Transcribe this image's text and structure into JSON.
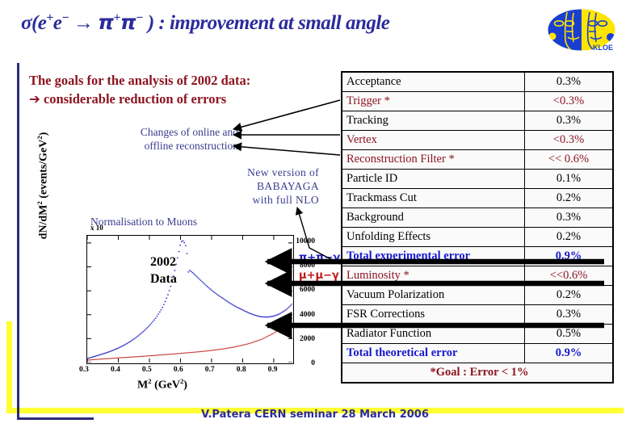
{
  "slide": {
    "title_pre": "σ(e",
    "title": "σ(e+e− → π+π−) : improvement at small angle",
    "title_tail": ") : improvement at small angle",
    "footer": "V.Patera CERN seminar 28 March 2006",
    "logo_name": "KLOE",
    "accent_navy": "#2b2b9c",
    "accent_dark_red": "#8c1420",
    "accent_blue": "#1818cf",
    "accent_yellow": "#ffff33"
  },
  "goals": {
    "line1": "The goals for the analysis of 2002 data:",
    "arrow": "➔",
    "line2": "considerable reduction of errors"
  },
  "annotations": {
    "changes_line1": "Changes of online and",
    "changes_line2": "offline reconstruction",
    "babayaga_line1": "New version of",
    "babayaga_line2": "BABAYAGA",
    "babayaga_line3": "with full NLO",
    "normalisation": "Normalisation to Muons"
  },
  "chart_data": {
    "type": "line",
    "title": "",
    "xlabel": "M² (GeV²)",
    "ylabel": "dN/dM² (events/GeV²)",
    "y_multiplier": "x 10",
    "inset_label_line1": "2002",
    "inset_label_line2": "Data",
    "xlim": [
      0.3,
      0.96
    ],
    "ylim": [
      0,
      10600
    ],
    "xticks": [
      0.3,
      0.4,
      0.5,
      0.6,
      0.7,
      0.8,
      0.9
    ],
    "xtick_labels": [
      "0.3",
      "0.4",
      "0.5",
      "0.6",
      "0.7",
      "0.8",
      "0.9"
    ],
    "yticks": [
      0,
      2000,
      4000,
      6000,
      8000,
      10000
    ],
    "ytick_labels": [
      "0",
      "2000",
      "4000",
      "6000",
      "8000",
      "10000"
    ],
    "grid": false,
    "legend_position": "top-right",
    "series": [
      {
        "name": "π+π−γ",
        "color": "#2020c8",
        "x": [
          0.3,
          0.32,
          0.34,
          0.36,
          0.38,
          0.4,
          0.42,
          0.44,
          0.46,
          0.48,
          0.5,
          0.52,
          0.54,
          0.55,
          0.56,
          0.57,
          0.58,
          0.59,
          0.6,
          0.605,
          0.61,
          0.62,
          0.625,
          0.63,
          0.64,
          0.65,
          0.66,
          0.68,
          0.7,
          0.72,
          0.74,
          0.76,
          0.78,
          0.8,
          0.82,
          0.84,
          0.86,
          0.88,
          0.9,
          0.92,
          0.94,
          0.96
        ],
        "values": [
          330,
          480,
          640,
          800,
          990,
          1210,
          1470,
          1780,
          2150,
          2580,
          3080,
          3700,
          4500,
          5050,
          5700,
          6500,
          7500,
          8700,
          9900,
          10200,
          10150,
          9600,
          7550,
          7700,
          7500,
          7250,
          7000,
          6500,
          6050,
          5650,
          5300,
          4950,
          4650,
          4400,
          4150,
          3950,
          3820,
          3800,
          3880,
          4080,
          4420,
          4900
        ]
      },
      {
        "name": "μ+μ−γ",
        "color": "#c01818",
        "x": [
          0.3,
          0.34,
          0.38,
          0.42,
          0.46,
          0.5,
          0.54,
          0.58,
          0.62,
          0.66,
          0.7,
          0.74,
          0.78,
          0.82,
          0.86,
          0.9,
          0.92,
          0.94,
          0.96
        ],
        "values": [
          200,
          280,
          350,
          420,
          490,
          560,
          640,
          720,
          810,
          900,
          1010,
          1150,
          1330,
          1580,
          1930,
          2450,
          2780,
          3180,
          3700
        ]
      }
    ]
  },
  "table": {
    "rows": [
      {
        "label": "Acceptance",
        "value": "0.3%",
        "style": "black",
        "struck": false
      },
      {
        "label": "Trigger *",
        "value": "<0.3%",
        "style": "red",
        "struck": false
      },
      {
        "label": "Tracking",
        "value": "0.3%",
        "style": "black",
        "struck": false
      },
      {
        "label": "Vertex",
        "value": "<0.3%",
        "style": "red",
        "struck": false
      },
      {
        "label": "Reconstruction Filter *",
        "value": "<< 0.6%",
        "style": "red",
        "struck": false
      },
      {
        "label": "Particle ID",
        "value": "0.1%",
        "style": "black",
        "struck": false
      },
      {
        "label": "Trackmass Cut",
        "value": "0.2%",
        "style": "black",
        "struck": false
      },
      {
        "label": "Background",
        "value": "0.3%",
        "style": "black",
        "struck": false
      },
      {
        "label": "Unfolding Effects",
        "value": "0.2%",
        "style": "black",
        "struck": false
      },
      {
        "label": "Total experimental error",
        "value": "0.9%",
        "style": "total",
        "struck": false
      },
      {
        "label": "Luminosity *",
        "value": "<<0.6%",
        "style": "red",
        "struck": true
      },
      {
        "label": "Vacuum Polarization",
        "value": "0.2%",
        "style": "black",
        "struck": true
      },
      {
        "label": "FSR Corrections",
        "value": "0.3%",
        "style": "black",
        "struck": false
      },
      {
        "label": "Radiator Function",
        "value": "0.5%",
        "style": "black",
        "struck": true
      },
      {
        "label": "Total theoretical error",
        "value": "0.9%",
        "style": "total",
        "struck": false
      }
    ],
    "goal": "*Goal : Error < 1%"
  }
}
